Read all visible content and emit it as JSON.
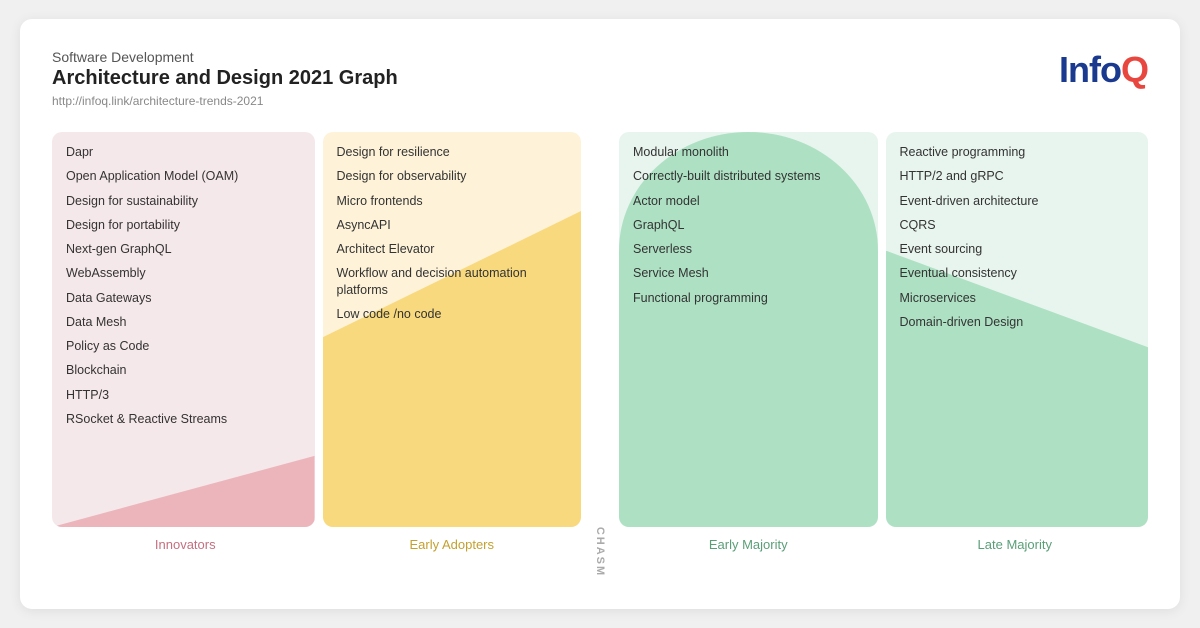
{
  "header": {
    "subtitle": "Software Development",
    "title": "Architecture and Design 2021 Graph",
    "url": "http://infoq.link/architecture-trends-2021",
    "logo_text": "Info",
    "logo_q": "Q"
  },
  "columns": [
    {
      "id": "innovators",
      "label": "Innovators",
      "items": [
        "Dapr",
        "Open Application Model (OAM)",
        "Design for sustainability",
        "Design for portability",
        "Next-gen GraphQL",
        "WebAssembly",
        "Data Gateways",
        "Data Mesh",
        "Policy as Code",
        "Blockchain",
        "HTTP/3",
        "RSocket & Reactive Streams"
      ]
    },
    {
      "id": "early-adopters",
      "label": "Early Adopters",
      "items": [
        "Design for resilience",
        "Design for observability",
        "Micro frontends",
        "AsyncAPI",
        "Architect Elevator",
        "Workflow and decision automation platforms",
        "Low code /no code"
      ]
    },
    {
      "id": "early-majority",
      "label": "Early Majority",
      "items": [
        "Modular monolith",
        "Correctly-built distributed systems",
        "Actor model",
        "GraphQL",
        "Serverless",
        "Service Mesh",
        "Functional programming"
      ]
    },
    {
      "id": "late-majority",
      "label": "Late Majority",
      "items": [
        "Reactive programming",
        "HTTP/2 and gRPC",
        "Event-driven architecture",
        "CQRS",
        "Event sourcing",
        "Eventual consistency",
        "Microservices",
        "Domain-driven Design"
      ]
    }
  ],
  "chasm_label": "CHASM"
}
